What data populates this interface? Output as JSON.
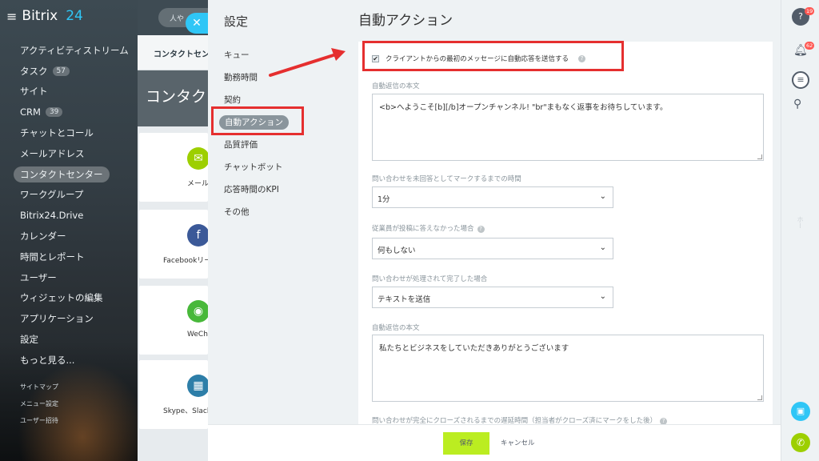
{
  "sidebar": {
    "brand": "Bitrix",
    "brand_num": "24",
    "items": [
      {
        "label": "アクティビティストリーム",
        "count": ""
      },
      {
        "label": "タスク",
        "count": "57"
      },
      {
        "label": "サイト",
        "count": ""
      },
      {
        "label": "CRM",
        "count": "39"
      },
      {
        "label": "チャットとコール",
        "count": ""
      },
      {
        "label": "メールアドレス",
        "count": ""
      },
      {
        "label": "コンタクトセンター",
        "count": ""
      },
      {
        "label": "ワークグループ",
        "count": ""
      },
      {
        "label": "Bitrix24.Drive",
        "count": ""
      },
      {
        "label": "カレンダー",
        "count": ""
      },
      {
        "label": "時間とレポート",
        "count": ""
      },
      {
        "label": "ユーザー",
        "count": ""
      },
      {
        "label": "ウィジェットの編集",
        "count": ""
      },
      {
        "label": "アプリケーション",
        "count": ""
      },
      {
        "label": "設定",
        "count": ""
      },
      {
        "label": "もっと見る...",
        "count": ""
      }
    ],
    "bottom": [
      "サイトマップ",
      "メニュー設定",
      "ユーザー招待"
    ]
  },
  "background": {
    "search_placeholder": "人や",
    "tab_label": "コンタクトセン",
    "page_title": "コンタク",
    "cards": [
      {
        "label": "メール",
        "icon": "envelope-icon",
        "color": "#9dcf00"
      },
      {
        "label": "Facebookリー",
        "icon": "facebook-icon",
        "color": "#3b5998"
      },
      {
        "label": "WeCha",
        "icon": "wechat-icon",
        "color": "#48b83a"
      },
      {
        "label": "Skype、Slack",
        "icon": "grid-icon",
        "color": "#2d7ea8"
      }
    ]
  },
  "panel": {
    "settings_title": "設定",
    "menu": [
      "キュー",
      "勤務時間",
      "契約",
      "自動アクション",
      "品質評価",
      "チャットボット",
      "応答時間のKPI",
      "その他"
    ],
    "active_index": 3,
    "title": "自動アクション",
    "checkbox_label": "クライアントからの最初のメッセージに自動応答を送信する",
    "checkbox_checked": true,
    "field1_label": "自動返信の本文",
    "field1_value": "<b>へようこそ[b][/b]オープンチャンネル! \"br\"まもなく返事をお待ちしています。",
    "field2_label": "問い合わせを未回答としてマークするまでの時間",
    "field2_value": "1分",
    "field3_label": "従業員が投稿に答えなかった場合",
    "field3_value": "何もしない",
    "field4_label": "問い合わせが処理されて完了した場合",
    "field4_value": "テキストを送信",
    "field5_label": "自動返信の本文",
    "field5_value": "私たちとビジネスをしていただきありがとうございます",
    "field6_label": "問い合わせが完全にクローズされるまでの遅延時間（担当者がクローズ済にマークをした後）",
    "save_label": "保存",
    "cancel_label": "キャンセル"
  },
  "right_bar": {
    "help_badge": "19",
    "bell_badge": "62",
    "vertical_text": "ホー"
  },
  "colors": {
    "accent": "#2fc6f6",
    "highlight": "#e52f2f",
    "save_button": "#bbed21"
  }
}
